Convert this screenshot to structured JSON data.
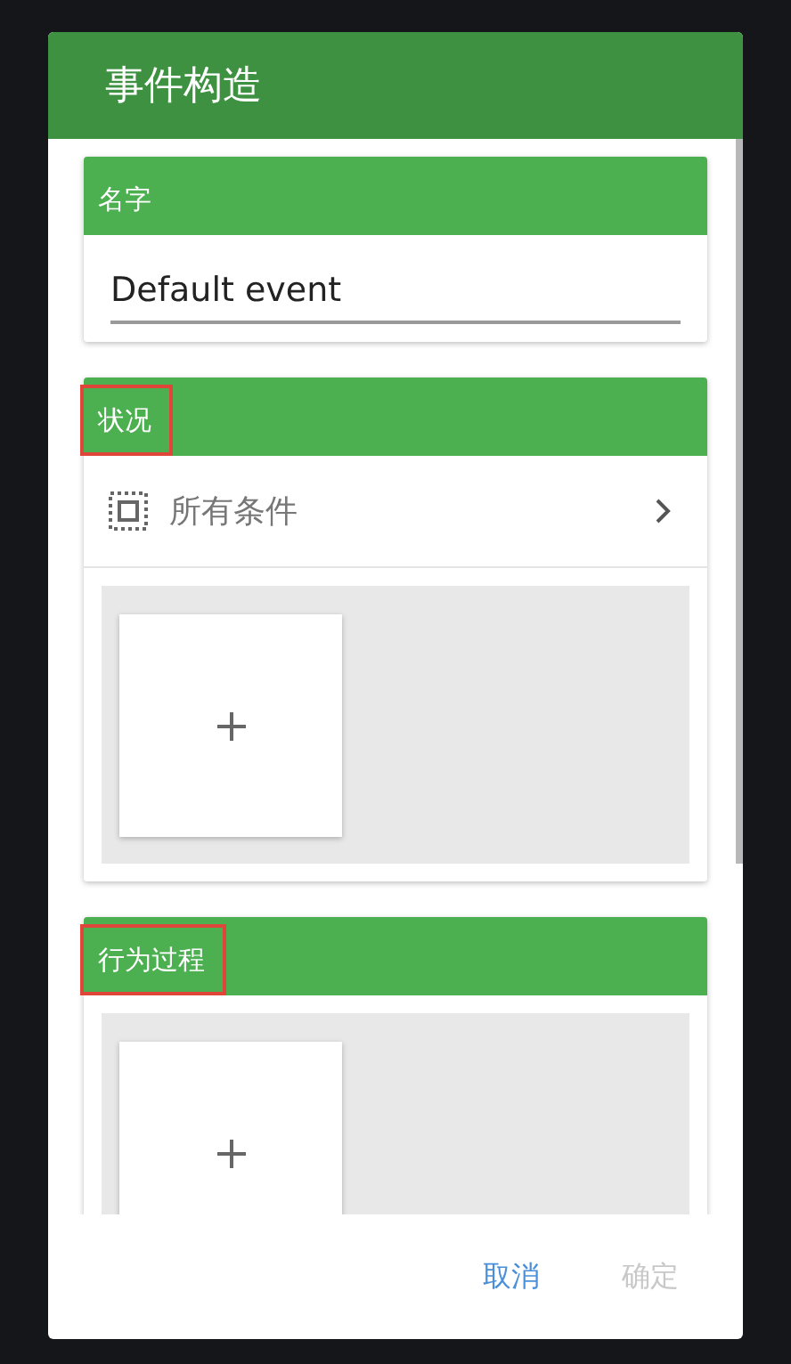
{
  "dialog": {
    "title": "事件构造"
  },
  "sections": [
    {
      "kind": "name",
      "title": "名字",
      "highlighted": false,
      "value": "Default event"
    },
    {
      "kind": "conditions",
      "title": "状况",
      "highlighted": true,
      "selector": {
        "label": "所有条件"
      },
      "slots": [
        {
          "kind": "add"
        }
      ]
    },
    {
      "kind": "actions",
      "title": "行为过程",
      "highlighted": true,
      "slots": [
        {
          "kind": "add"
        }
      ]
    }
  ],
  "buttons": [
    {
      "label": "取消",
      "disabled": false
    },
    {
      "label": "确定",
      "disabled": true
    }
  ]
}
